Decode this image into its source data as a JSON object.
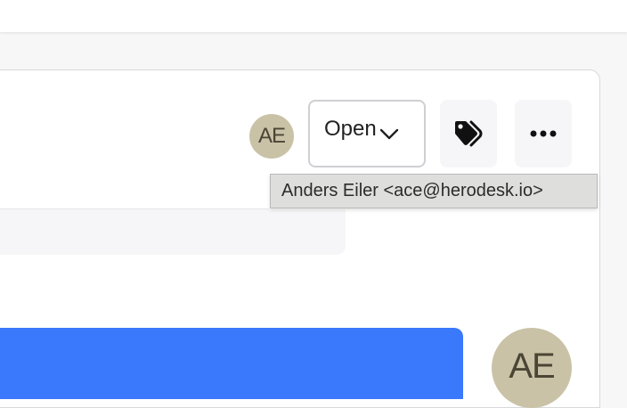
{
  "header": {
    "assignee_initials": "AE",
    "status_select": {
      "value": "Open"
    },
    "tags_button_icon": "tags-icon",
    "more_button_icon": "more-horizontal-icon"
  },
  "tooltip": {
    "text": "Anders Eiler <ace@herodesk.io>"
  },
  "thread": {
    "author_initials": "AE"
  },
  "colors": {
    "accent": "#3a78fc",
    "avatar": "#c9c2a6"
  }
}
